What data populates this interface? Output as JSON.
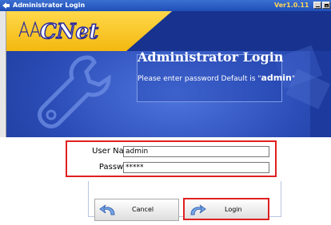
{
  "window": {
    "title": "Administrator Login",
    "version": "Ver1.0.11"
  },
  "banner": {
    "logo_text": "CNet",
    "heading": "Administrator Login",
    "subtitle_prefix": "Please enter password Default is \"",
    "default_password": "admin",
    "subtitle_suffix": "\""
  },
  "form": {
    "username_label": "User Name:",
    "username_value": "admin",
    "password_label": "Password:",
    "password_mask": "*****"
  },
  "buttons": {
    "cancel_label": "Cancel",
    "login_label": "Login"
  },
  "colors": {
    "titlebar": "#1e4fb8",
    "banner_blue": "#1d3a9e",
    "banner_yellow": "#f4b810",
    "highlight": "#e02020"
  },
  "icons": {
    "app": "window-app-icon",
    "wrench": "wrench-icon",
    "cancel": "cancel-arrow-icon",
    "login": "login-arrow-icon"
  }
}
